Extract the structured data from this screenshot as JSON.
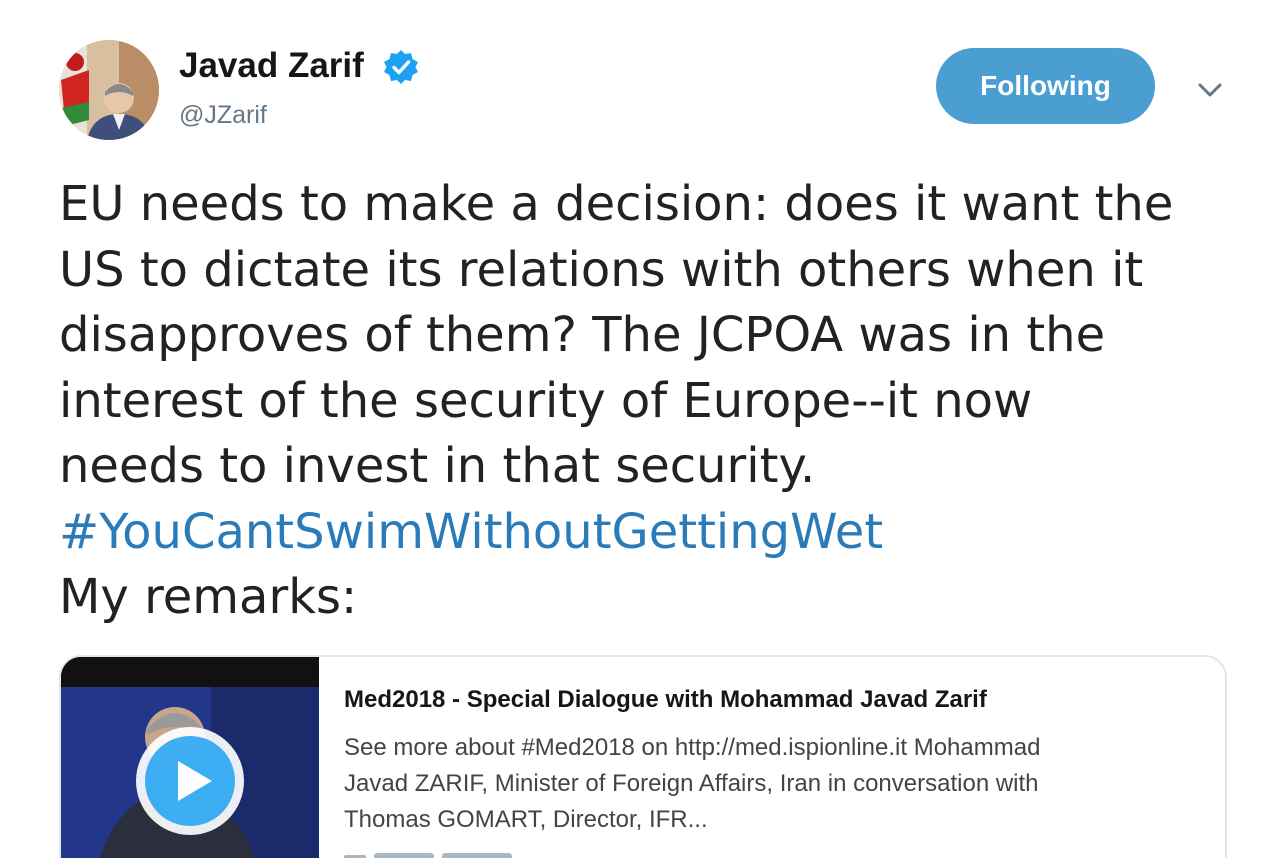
{
  "user": {
    "display_name": "Javad Zarif",
    "handle": "@JZarif",
    "verified": true,
    "avatar_icon": "profile-photo"
  },
  "actions": {
    "follow_label": "Following",
    "menu_icon": "chevron-down-icon"
  },
  "tweet": {
    "lines": [
      "EU needs to make a decision: does it want the",
      "US to dictate its relations with others when it",
      "disapproves of them? The JCPOA was in the",
      "interest of the security of Europe--it now",
      "needs to invest in that security."
    ],
    "hashtag": "#YouCantSwimWithoutGettingWet",
    "closing": "My remarks:"
  },
  "card": {
    "title": "Med2018 - Special Dialogue with Mohammad Javad Zarif",
    "description_lines": [
      "See more about #Med2018 on http://med.ispionline.it Mohammad",
      "Javad ZARIF, Minister of Foreign Affairs, Iran in conversation with",
      "Thomas GOMART, Director, IFR..."
    ],
    "thumbnail_icon": "video-thumbnail",
    "play_icon": "play-icon"
  },
  "colors": {
    "accent": "#4a9ed2",
    "link": "#2b7bb9",
    "text": "#222222",
    "muted": "#657786",
    "border": "#e1e8ed"
  }
}
